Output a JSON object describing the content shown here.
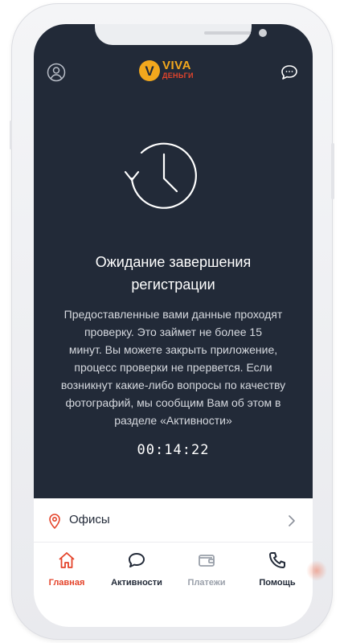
{
  "brand": {
    "name_top": "VIVA",
    "name_bottom": "ДЕНЬГИ",
    "logo_letter": "V",
    "colors": {
      "gold": "#f2a81d",
      "red": "#e4442b"
    }
  },
  "header": {
    "profile_icon": "user-circle-icon",
    "chat_icon": "chat-bubble-icon"
  },
  "status": {
    "icon": "clock-history-icon",
    "title_line1": "Ожидание завершения",
    "title_line2": "регистрации",
    "description_lines": [
      "Предоставленные вами данные проходят",
      "проверку. Это займет не более 15",
      "минут. Вы можете закрыть приложение,",
      "процесс проверки не прервется. Если",
      "возникнут какие-либо вопросы по качеству",
      "фотографий, мы сообщим Вам об этом в",
      "разделе «Активности»"
    ],
    "timer": "00:14:22"
  },
  "offices_row": {
    "icon": "location-pin-icon",
    "label": "Офисы",
    "chevron": "chevron-right-icon"
  },
  "tabs": [
    {
      "label": "Главная",
      "icon": "home-icon",
      "active": true
    },
    {
      "label": "Активности",
      "icon": "chat-icon",
      "active": false
    },
    {
      "label": "Платежи",
      "icon": "wallet-icon",
      "active": false
    },
    {
      "label": "Помощь",
      "icon": "phone-icon",
      "active": false
    }
  ],
  "colors": {
    "background_dark": "#222a38",
    "accent": "#e4442b",
    "tab_active": "#e4442b",
    "tab_default": "#222a38",
    "tab_disabled": "#9aa0aa"
  }
}
